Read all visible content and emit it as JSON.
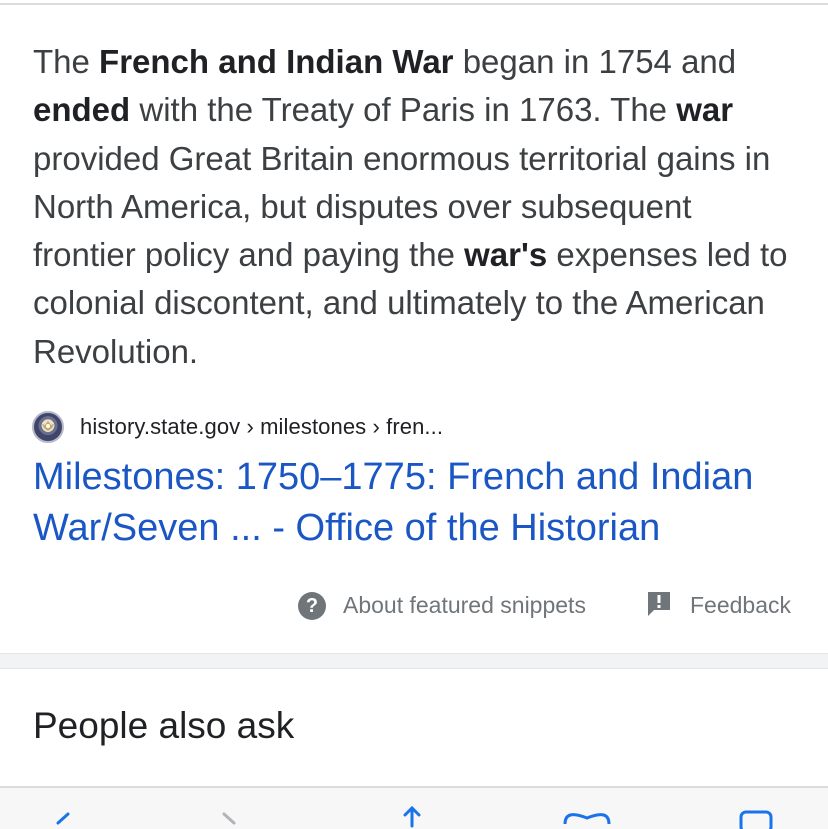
{
  "snippet": {
    "parts": [
      {
        "text": "The ",
        "bold": false
      },
      {
        "text": "French and Indian War",
        "bold": true
      },
      {
        "text": " began in 1754 and ",
        "bold": false
      },
      {
        "text": "ended",
        "bold": true
      },
      {
        "text": " with the Treaty of Paris in 1763. The ",
        "bold": false
      },
      {
        "text": "war",
        "bold": true
      },
      {
        "text": " provided Great Britain enormous territorial gains in North America, but disputes over subsequent frontier policy and paying the ",
        "bold": false
      },
      {
        "text": "war's",
        "bold": true
      },
      {
        "text": " expenses led to colonial discontent, and ultimately to the American Revolution.",
        "bold": false
      }
    ]
  },
  "source": {
    "breadcrumb": "history.state.gov › milestones › fren...",
    "favicon_icon": "state-department-seal-icon"
  },
  "result": {
    "title": "Milestones: 1750–1775: French and Indian War/Seven ... - Office of the Historian",
    "color": "#1a57c5"
  },
  "footer": {
    "about_label": "About featured snippets",
    "about_icon": "help-circle-icon",
    "feedback_label": "Feedback",
    "feedback_icon": "feedback-icon"
  },
  "people_also_ask": {
    "title": "People also ask"
  },
  "toolbar": {
    "icons": [
      "back-arrow-icon",
      "forward-arrow-icon",
      "share-icon",
      "bookmarks-icon",
      "tabs-icon"
    ]
  }
}
